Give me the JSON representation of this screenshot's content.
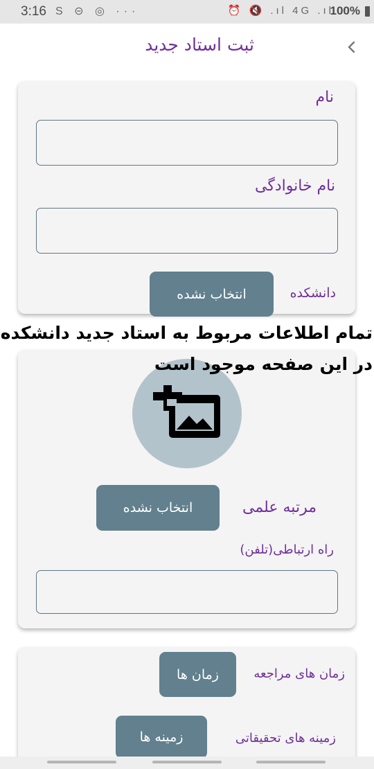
{
  "status_bar": {
    "time": "3:16",
    "left_icons": "S ⊝ ◎ ···",
    "right_icons": "⏰ 🔇 .ıl 4G .ıl",
    "battery": "100%"
  },
  "header": {
    "title": "ثبت استاد جدید",
    "back_icon": "chevron-left-icon"
  },
  "form": {
    "first_name": {
      "label": "نام",
      "value": ""
    },
    "last_name": {
      "label": "نام خانوادگی",
      "value": ""
    },
    "faculty": {
      "label": "دانشکده",
      "button": "انتخاب نشده"
    },
    "academic_rank": {
      "label": "مرتبه علمی",
      "button": "انتخاب نشده"
    },
    "contact": {
      "label": "راه ارتباطی(تلفن)",
      "value": ""
    },
    "visit_times": {
      "label": "زمان های مراجعه",
      "button": "زمان ها"
    },
    "research_fields": {
      "label": "زمینه های تحقیقاتی",
      "button": "زمینه ها"
    }
  },
  "photo": {
    "icon": "add-photo-icon"
  },
  "overlay": {
    "line1": "تمام اطلاعات مربوط به استاد جدید دانشکده",
    "line2": "در این صفحه موجود است"
  },
  "colors": {
    "accent": "#6f2f9a",
    "button": "#62808e",
    "card": "#f4f4f4",
    "photo_circle": "#b3c3cb"
  }
}
